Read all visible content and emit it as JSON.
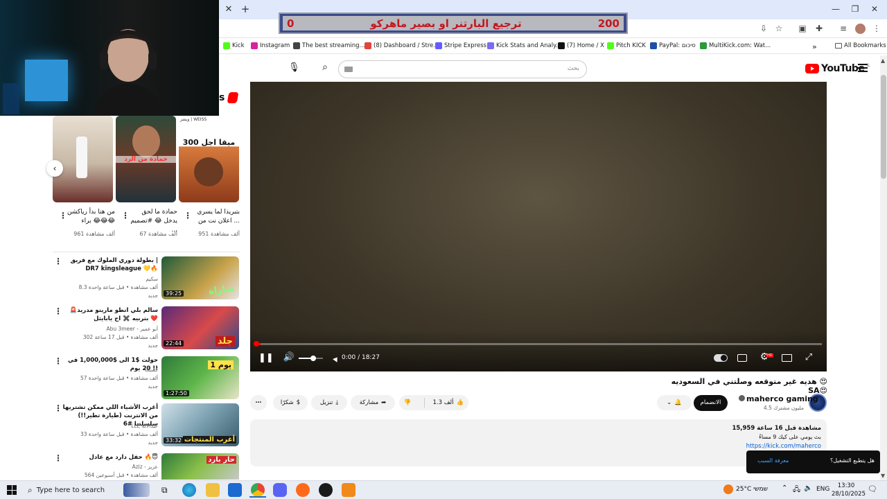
{
  "overlay": {
    "banner_left_score": "200",
    "banner_title": "ترجيع البارتنر او بصير ماهركو",
    "banner_right_score": "0"
  },
  "bookmarks": [
    {
      "label": "Kick",
      "color": "#53fc18"
    },
    {
      "label": "Instagram",
      "color": "#d6249f"
    },
    {
      "label": "The best streaming...",
      "color": "#444444"
    },
    {
      "label": "(8) Dashboard / Stre...",
      "color": "#e0463c"
    },
    {
      "label": "Stripe Express",
      "color": "#635bff"
    },
    {
      "label": "Kick Stats and Analy...",
      "color": "#7a6cf0"
    },
    {
      "label": "(7) Home / X",
      "color": "#111111"
    },
    {
      "label": "Pitch KICK",
      "color": "#53fc18"
    },
    {
      "label": "PayPal: סיכום",
      "color": "#1e4fa8"
    },
    {
      "label": "MultiKick.com: Wat...",
      "color": "#2b9a3a"
    }
  ],
  "bookmarks_more": "»",
  "all_bookmarks": "All Bookmarks",
  "youtube": {
    "logo_text": "YouTube",
    "logo_region": "IL",
    "search_placeholder": "بحث",
    "shorts_label": "s",
    "shorts": [
      {
        "title": "بتبريذا لما يسري اعلان نت من ...",
        "views": "951 ألف مشاهدة",
        "overlay_text": "300 ميقا اجل",
        "channel_tag": "ويشز | WEISS"
      },
      {
        "title": "حمادة ما لحق يدخل 😂 #تصميم ...",
        "views": "67 ألف مشاهدة",
        "overlay_text": "حمادة من الرد"
      },
      {
        "title": "من هنا بدأ رياكشن براء 😂😂😂",
        "views": "961 ألف مشاهدة",
        "overlay_text": ""
      }
    ],
    "recommendations": [
      {
        "title": "بطولة دوري الملوك مع فريق | DR7 kingsleague 💛🔥",
        "channel": "سكيم",
        "meta": "8.3 ألف مشاهدة • قبل ساعة واحدة",
        "badge": "جديد",
        "duration": "39:25",
        "thumb_text": "مباراة"
      },
      {
        "title": "🚨سالم بلي انطو مارينو مدريد بتربيه ✖️ اح يابايثل ❤️",
        "channel": "Abu 3meer - أبو عمير",
        "meta": "302 ألف مشاهدة • قبل 17 ساعة",
        "badge": "جديد",
        "duration": "22:44",
        "thumb_text": "جلد"
      },
      {
        "title": "حولت $1 الى $1,000,000 في 20 يوم !!",
        "channel": "كسنكا",
        "meta": "57 ألف مشاهدة • قبل ساعة واحدة",
        "badge": "جديد",
        "duration": "1:27:50",
        "thumb_text": "يوم 1"
      },
      {
        "title": "أغرب الأشياء اللي ممكن تشتريها من الانترنت (طيارة تطير!!) سلسلتنا #6",
        "channel": "LLE عبدالاله",
        "meta": "33 ألف مشاهدة • قبل ساعة واحدة",
        "badge": "جديد",
        "duration": "33:32",
        "thumb_text": "أغرب المنتجات"
      },
      {
        "title": "حفل دارد مع عادل 🔥😇",
        "channel": "Aziz - عزيز",
        "meta": "564 ألف مشاهدة • قبل أسبوعين",
        "badge": "",
        "duration": "",
        "thumb_text": "حار بارد"
      }
    ],
    "player": {
      "time_current": "0:00",
      "time_total": "18:27",
      "progress": 0.01,
      "volume": 0.6,
      "hd_badge": "HD"
    },
    "video_title": "هديه غير متوقعه وصلتني في السعوديه 😍SA😍",
    "channel_name": "maherco gaming",
    "subscribers": "4.5 مليون مشترك",
    "join_label": "الانضمام",
    "likes_label": "1.3 ألف",
    "share_label": "مشاركة",
    "download_label": "تنزيل",
    "thanks_label": "شكرًا",
    "description": {
      "stats": "15,959 مشاهدة قبل 16 ساعة",
      "line2": "بث يومي على كيك 9 مساءً",
      "link": "https://kick.com/maherco"
    },
    "toast": {
      "question": "هل يتطبع التشغيل؟",
      "action": "معرفة السبب"
    }
  },
  "taskbar": {
    "search_placeholder": "Type here to search",
    "weather": "25°C שמשי",
    "language": "ENG",
    "time": "13:30",
    "date": "28/10/2025"
  }
}
